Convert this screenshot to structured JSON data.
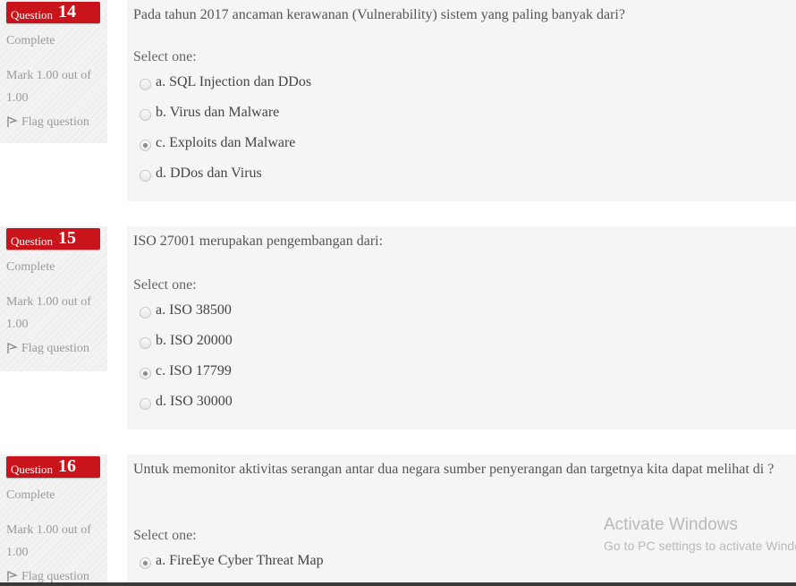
{
  "questions": [
    {
      "word": "Question",
      "number": "14",
      "state": "Complete",
      "grade": "Mark 1.00 out of 1.00",
      "flag_label": "Flag question",
      "text": "Pada tahun 2017 ancaman kerawanan (Vulnerability) sistem yang paling banyak dari?",
      "prompt": "Select one:",
      "options": [
        {
          "label": "a. SQL Injection dan DDos",
          "checked": false
        },
        {
          "label": "b. Virus dan Malware",
          "checked": false
        },
        {
          "label": "c. Exploits dan Malware",
          "checked": true
        },
        {
          "label": "d. DDos dan Virus",
          "checked": false
        }
      ]
    },
    {
      "word": "Question",
      "number": "15",
      "state": "Complete",
      "grade": "Mark 1.00 out of 1.00",
      "flag_label": "Flag question",
      "text": "ISO 27001 merupakan pengembangan dari:",
      "prompt": "Select one:",
      "options": [
        {
          "label": "a. ISO 38500",
          "checked": false
        },
        {
          "label": "b. ISO 20000",
          "checked": false
        },
        {
          "label": "c. ISO 17799",
          "checked": true
        },
        {
          "label": "d. ISO 30000",
          "checked": false
        }
      ]
    },
    {
      "word": "Question",
      "number": "16",
      "state": "Complete",
      "grade": "Mark 1.00 out of 1.00",
      "flag_label": "Flag question",
      "text": "Untuk memonitor aktivitas serangan antar dua negara sumber penyerangan dan targetnya kita dapat melihat di ?",
      "prompt": "Select one:",
      "options": [
        {
          "label": "a. FireEye Cyber Threat Map",
          "checked": true
        }
      ]
    }
  ],
  "watermark": {
    "title": "Activate Windows",
    "subtitle": "Go to PC settings to activate Windows."
  },
  "colors": {
    "question_badge": "#c9141b",
    "panel_bg": "#f5f5f5",
    "info_bg": "#f3f3f3"
  },
  "icons": [
    "flag-icon",
    "radio-button"
  ]
}
